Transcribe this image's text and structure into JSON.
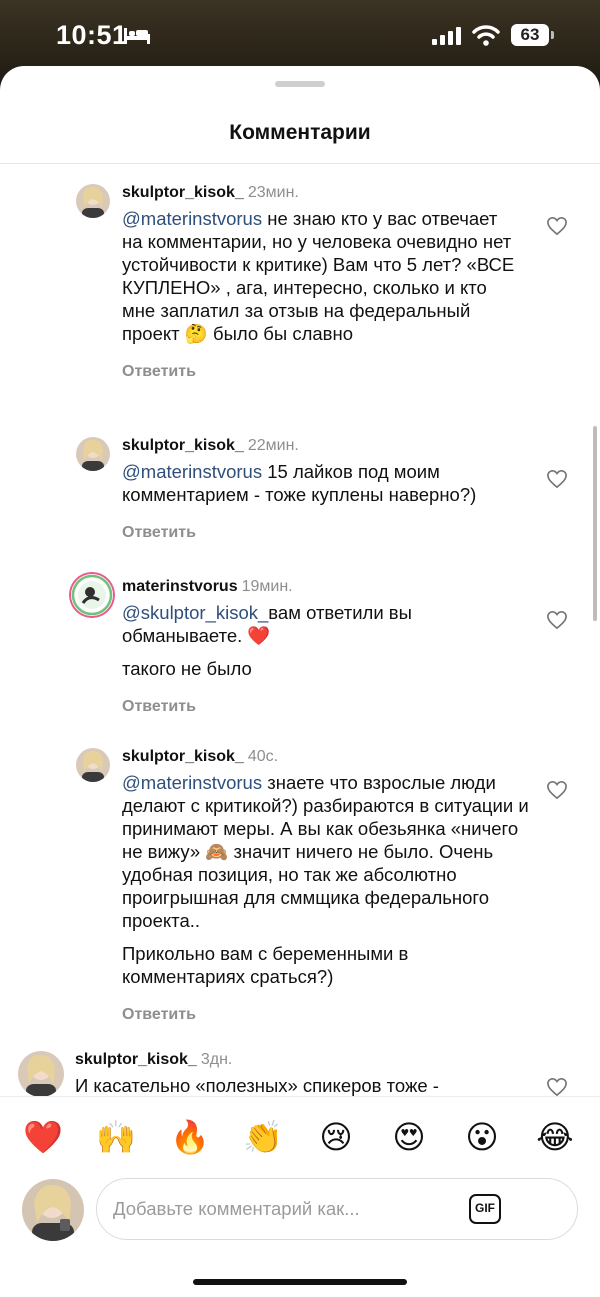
{
  "status_bar": {
    "time": "10:51",
    "battery": "63"
  },
  "sheet": {
    "title": "Комментарии"
  },
  "comments": [
    {
      "username": "skulptor_kisok_",
      "time": "23мин.",
      "mention": "@materinstvorus",
      "text": " не знаю кто у вас отвечает на комментарии, но у человека очевидно нет устойчивости к критике) Вам что 5 лет? «ВСЕ КУПЛЕНО» , ага, интересно, сколько и кто мне заплатил за отзыв на федеральный проект 🤔 было бы славно",
      "reply": "Ответить"
    },
    {
      "username": "skulptor_kisok_",
      "time": "22мин.",
      "mention": "@materinstvorus",
      "text": " 15 лайков под моим комментарием - тоже куплены наверно?)",
      "reply": "Ответить"
    },
    {
      "username": "materinstvorus",
      "time": "19мин.",
      "mention": "@skulptor_kisok_",
      "text": "вам ответили вы обманываете. ❤️",
      "text2": "такого не было",
      "reply": "Ответить"
    },
    {
      "username": "skulptor_kisok_",
      "time": "40с.",
      "mention": "@materinstvorus",
      "text": " знаете что взрослые люди делают с критикой?) разбираются в ситуации и принимают меры. А вы как обезьянка «ничего не вижу» 🙈 значит ничего не было. Очень удобная позиция, но так же абсолютно проигрышная для сммщика федерального проекта..",
      "text2": "Прикольно вам с беременными в комментариях сраться?)",
      "reply": "Ответить"
    },
    {
      "username": "skulptor_kisok_",
      "time": "3дн.",
      "text": "И касательно «полезных» спикеров тоже -"
    }
  ],
  "emoji_bar": [
    "❤️",
    "🙌",
    "🔥",
    "👏",
    "😢",
    "😍",
    "😮",
    "😂"
  ],
  "composer": {
    "placeholder": "Добавьте комментарий как...",
    "gif_label": "GIF"
  },
  "colors": {
    "mention": "#2f4f7b",
    "meta": "#8e8e8e",
    "heart_emoji": "#e0243a"
  }
}
